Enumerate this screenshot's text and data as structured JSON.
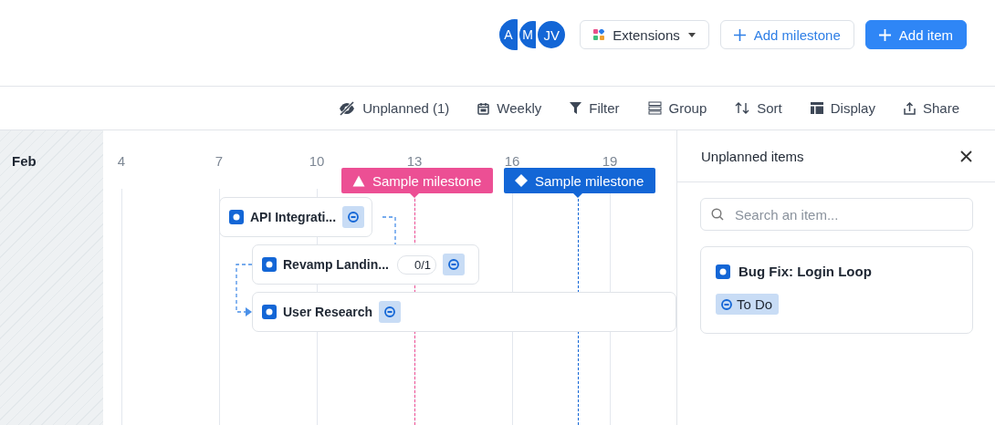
{
  "header": {
    "avatars": [
      "A",
      "M",
      "JV"
    ],
    "extensions_button": "Extensions",
    "add_milestone_button": "Add milestone",
    "add_item_button": "Add item"
  },
  "toolbar": [
    {
      "label": "Unplanned (1)",
      "kind": "unplanned"
    },
    {
      "label": "Weekly",
      "kind": "calendar"
    },
    {
      "label": "Filter",
      "kind": "filter"
    },
    {
      "label": "Group",
      "kind": "group"
    },
    {
      "label": "Sort",
      "kind": "sort"
    },
    {
      "label": "Display",
      "kind": "display"
    },
    {
      "label": "Share",
      "kind": "share"
    }
  ],
  "timeline": {
    "month": "Feb",
    "days": [
      "4",
      "7",
      "10",
      "13",
      "16",
      "19"
    ],
    "milestones": [
      {
        "label": "Sample milestone",
        "kind": "triangle",
        "color": "#ec4f94"
      },
      {
        "label": "Sample milestone",
        "kind": "diamond",
        "color": "#1366d6"
      }
    ],
    "items": [
      {
        "title": "API Integrati..."
      },
      {
        "title": "Revamp Landin...",
        "subtasks": "0/1"
      },
      {
        "title": "User Research"
      }
    ]
  },
  "unplanned_panel": {
    "title": "Unplanned items",
    "search": {
      "placeholder": "Search an item..."
    },
    "items": [
      {
        "title": "Bug Fix: Login Loop",
        "status": "To Do"
      }
    ]
  }
}
